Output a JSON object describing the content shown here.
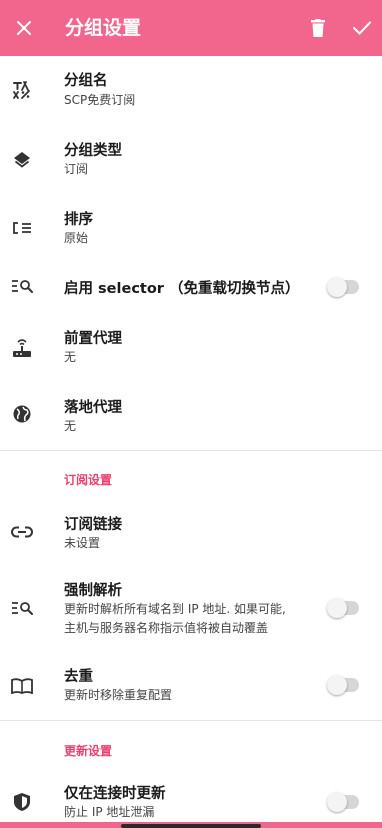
{
  "appbar": {
    "title": "分组设置",
    "close_icon": "close-icon",
    "delete_icon": "trash-icon",
    "confirm_icon": "check-icon"
  },
  "colors": {
    "accent": "#f2668e",
    "section": "#e8416f"
  },
  "settings": {
    "group_name": {
      "label": "分组名",
      "value": "SCP免费订阅",
      "icon": "rename-icon"
    },
    "group_type": {
      "label": "分组类型",
      "value": "订阅",
      "icon": "layers-icon"
    },
    "sort": {
      "label": "排序",
      "value": "原始",
      "icon": "sort-list-icon"
    },
    "selector": {
      "label": "启用 selector （免重载切换节点）",
      "icon": "list-search-icon",
      "enabled": false
    },
    "front_proxy": {
      "label": "前置代理",
      "value": "无",
      "icon": "router-icon"
    },
    "landing_proxy": {
      "label": "落地代理",
      "value": "无",
      "icon": "globe-icon"
    }
  },
  "subscription_section": {
    "header": "订阅设置",
    "link": {
      "label": "订阅链接",
      "value": "未设置",
      "icon": "link-icon"
    },
    "force_resolve": {
      "label": "强制解析",
      "desc_line1": "更新时解析所有域名到 IP 地址. 如果可能,",
      "desc_line2": "主机与服务器名称指示值将被自动覆盖",
      "icon": "list-search-icon",
      "enabled": false
    },
    "dedup": {
      "label": "去重",
      "desc": "更新时移除重复配置",
      "icon": "book-icon",
      "enabled": false
    }
  },
  "update_section": {
    "header": "更新设置",
    "only_when_connected": {
      "label": "仅在连接时更新",
      "desc": "防止 IP 地址泄漏",
      "icon": "shield-icon",
      "enabled": false
    }
  }
}
